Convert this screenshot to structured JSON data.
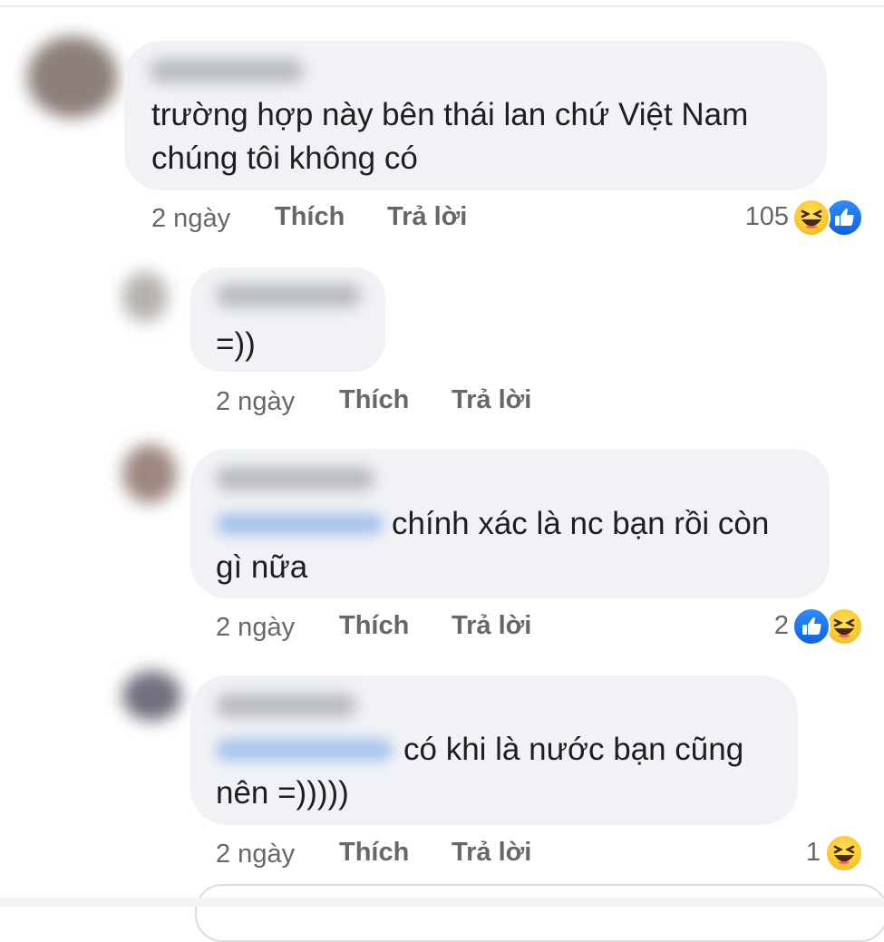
{
  "comments": [
    {
      "text_lines": [
        "trường hợp này bên thái lan chứ Việt Nam",
        "chúng tôi không có"
      ],
      "time": "2 ngày",
      "like_label": "Thích",
      "reply_label": "Trả lời",
      "reaction_count": "105",
      "reactions": [
        "haha-icon",
        "like-icon"
      ]
    },
    {
      "text_lines": [
        "=))"
      ],
      "time": "2 ngày",
      "like_label": "Thích",
      "reply_label": "Trả lời",
      "reaction_count": "",
      "reactions": []
    },
    {
      "text_lines": [
        "chính xác là nc bạn rồi còn",
        "gì nữa"
      ],
      "time": "2 ngày",
      "like_label": "Thích",
      "reply_label": "Trả lời",
      "reaction_count": "2",
      "reactions": [
        "like-icon",
        "haha-icon"
      ]
    },
    {
      "text_lines": [
        "có khi là nước bạn cũng",
        "nên =)))))"
      ],
      "time": "2 ngày",
      "like_label": "Thích",
      "reply_label": "Trả lời",
      "reaction_count": "1",
      "reactions": [
        "haha-icon"
      ]
    }
  ],
  "colors": {
    "bubble": "#f0f2f5",
    "meta_text": "#65676b",
    "like_blue": "#1877f2",
    "haha_yellow": "#fdc82f"
  }
}
